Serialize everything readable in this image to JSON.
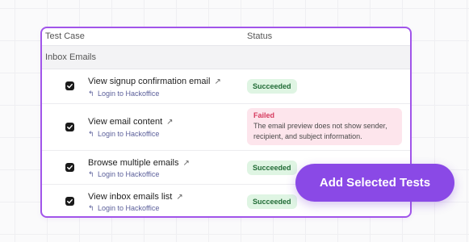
{
  "table": {
    "col_test_case": "Test Case",
    "col_status": "Status",
    "group_label": "Inbox Emails",
    "rows": [
      {
        "title": "View signup confirmation email",
        "subtitle": "Login to Hackoffice",
        "status": "Succeeded"
      },
      {
        "title": "View email content",
        "subtitle": "Login to Hackoffice",
        "status": "Failed",
        "status_detail": "The email preview does not show sender, recipient, and subject information."
      },
      {
        "title": "Browse multiple emails",
        "subtitle": "Login to Hackoffice",
        "status": "Succeeded"
      },
      {
        "title": "View inbox emails list",
        "subtitle": "Login to Hackoffice",
        "status": "Succeeded"
      }
    ]
  },
  "actions": {
    "add_selected": "Add Selected Tests"
  },
  "colors": {
    "accent": "#8a49e6",
    "success_bg": "#dff5e3",
    "failed_bg": "#fde5ec",
    "failed_text": "#d63a5e"
  }
}
